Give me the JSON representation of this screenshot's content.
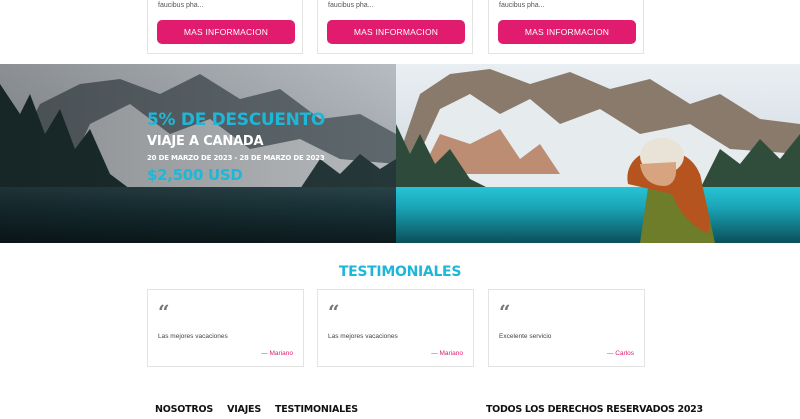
{
  "tours": [
    {
      "excerpt": "faucibus pha...",
      "button_label": "MAS INFORMACION"
    },
    {
      "excerpt": "faucibus pha...",
      "button_label": "MAS INFORMACION"
    },
    {
      "excerpt": "faucibus pha...",
      "button_label": "MAS INFORMACION"
    }
  ],
  "promo": {
    "discount": "5% DE DESCUENTO",
    "trip": "VIAJE A CANADA",
    "dates": "20 DE MARZO DE 2023 - 28 DE MARZO DE 2023",
    "price": "$2,500 USD"
  },
  "testimonials": {
    "title": "TESTIMONIALES",
    "items": [
      {
        "quote_mark": "“",
        "message": "Las mejores vacaciones",
        "author": "— Mariano"
      },
      {
        "quote_mark": "“",
        "message": "Las mejores vacaciones",
        "author": "— Mariano"
      },
      {
        "quote_mark": "“",
        "message": "Excelente servicio",
        "author": "— Carlos"
      }
    ]
  },
  "footer": {
    "nav": [
      "NOSOTROS",
      "VIAJES",
      "TESTIMONIALES"
    ],
    "copyright": "TODOS LOS DERECHOS RESERVADOS 2023"
  },
  "colors": {
    "accent_pink": "#e11b6d",
    "accent_cyan": "#1fb7d8"
  }
}
